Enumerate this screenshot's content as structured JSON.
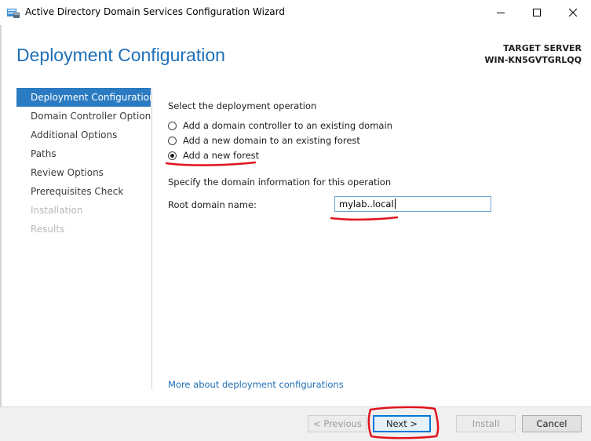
{
  "window": {
    "title": "Active Directory Domain Services Configuration Wizard"
  },
  "header": {
    "page_title": "Deployment Configuration",
    "target_label": "TARGET SERVER",
    "target_name": "WIN-KN5GVTGRLQQ"
  },
  "sidebar": {
    "items": [
      {
        "label": "Deployment Configuration",
        "state": "active"
      },
      {
        "label": "Domain Controller Options",
        "state": "normal"
      },
      {
        "label": "Additional Options",
        "state": "normal"
      },
      {
        "label": "Paths",
        "state": "normal"
      },
      {
        "label": "Review Options",
        "state": "normal"
      },
      {
        "label": "Prerequisites Check",
        "state": "normal"
      },
      {
        "label": "Installation",
        "state": "disabled"
      },
      {
        "label": "Results",
        "state": "disabled"
      }
    ]
  },
  "main": {
    "operation_heading": "Select the deployment operation",
    "options": [
      {
        "label": "Add a domain controller to an existing domain",
        "checked": false
      },
      {
        "label": "Add a new domain to an existing forest",
        "checked": false
      },
      {
        "label": "Add a new forest",
        "checked": true
      }
    ],
    "domain_heading": "Specify the domain information for this operation",
    "root_domain_label": "Root domain name:",
    "root_domain_value": "mylab..local",
    "more_link": "More about deployment configurations"
  },
  "footer": {
    "previous_label": "< Previous",
    "next_label": "Next >",
    "install_label": "Install",
    "cancel_label": "Cancel"
  },
  "colors": {
    "accent": "#1f6fb6",
    "nav_active": "#2a7bc1",
    "annotation": "#e0141e"
  }
}
